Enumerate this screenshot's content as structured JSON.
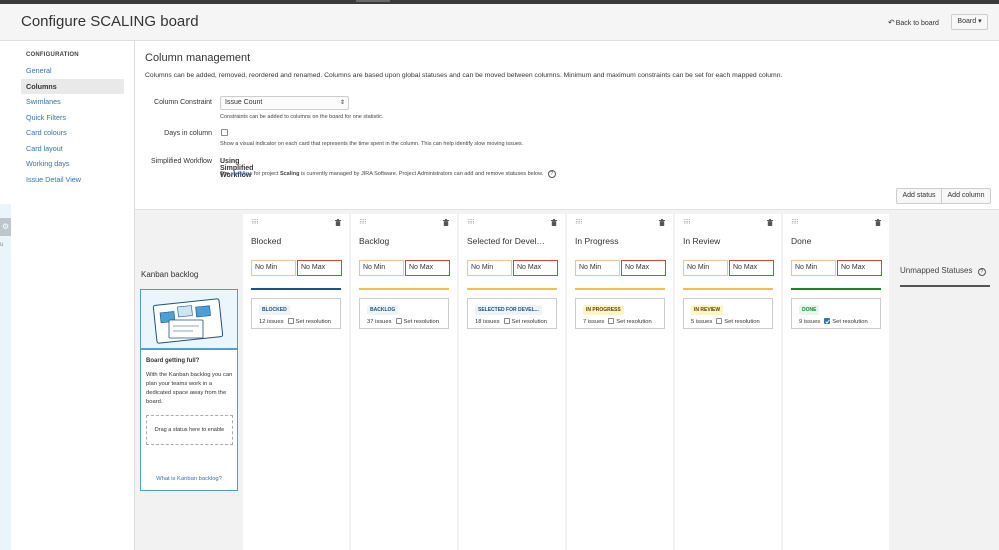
{
  "header": {
    "title": "Configure SCALING board",
    "back_link": "Back to board",
    "board_button": "Board"
  },
  "sidebar": {
    "section": "CONFIGURATION",
    "items": [
      {
        "label": "General"
      },
      {
        "label": "Columns"
      },
      {
        "label": "Swimlanes"
      },
      {
        "label": "Quick Filters"
      },
      {
        "label": "Card colours"
      },
      {
        "label": "Card layout"
      },
      {
        "label": "Working days"
      },
      {
        "label": "Issue Detail View"
      }
    ]
  },
  "main": {
    "title": "Column management",
    "description": "Columns can be added, removed, reordered and renamed. Columns are based upon global statuses and can be moved between columns. Minimum and maximum constraints can be set for each mapped column.",
    "constraint": {
      "label": "Column Constraint",
      "value": "Issue Count",
      "help": "Constraints can be added to columns on the board for one statistic."
    },
    "days_in_column": {
      "label": "Days in column",
      "checked": false,
      "help": "Show a visual indicator on each card that represents the time spent in the column. This can help identify slow moving issues."
    },
    "workflow": {
      "label": "Simplified Workflow",
      "value": "Using Simplified Workflow",
      "help_prefix": "The",
      "help_link": "workflow",
      "help_mid": "for project",
      "help_project": "Scaling",
      "help_suffix": "is currently managed by JIRA Software. Project Administrators can add and remove statuses below."
    },
    "add_status": "Add status",
    "add_column": "Add column"
  },
  "kanban": {
    "title": "Kanban backlog",
    "card_heading": "Board getting full?",
    "card_body": "With the Kanban backlog you can plan your teams work in a dedicated space away from the board.",
    "dropzone": "Drag a status here to enable",
    "link": "What is Kanban backlog?"
  },
  "columns": [
    {
      "name": "Blocked",
      "min": "No Min",
      "max": "No Max",
      "bar_color": "#205081",
      "status": "BLOCKED",
      "status_color": "#205081",
      "status_bg": "#eef3f8",
      "issues": "12 issues",
      "resolution": "Set resolution",
      "resolution_checked": false
    },
    {
      "name": "Backlog",
      "min": "No Min",
      "max": "No Max",
      "bar_color": "#f0c040",
      "status": "BACKLOG",
      "status_color": "#205081",
      "status_bg": "#eef3f8",
      "issues": "37 issues",
      "resolution": "Set resolution",
      "resolution_checked": false
    },
    {
      "name": "Selected for Devel…",
      "min": "No Min",
      "max": "No Max",
      "bar_color": "#f0c040",
      "status": "SELECTED FOR DEVEL...",
      "status_color": "#205081",
      "status_bg": "#eef3f8",
      "issues": "18 issues",
      "resolution": "Set resolution",
      "resolution_checked": false
    },
    {
      "name": "In Progress",
      "min": "No Min",
      "max": "No Max",
      "bar_color": "#f0c040",
      "status": "IN PROGRESS",
      "status_color": "#594300",
      "status_bg": "#fff4c4",
      "issues": "7 issues",
      "resolution": "Set resolution",
      "resolution_checked": false
    },
    {
      "name": "In Review",
      "min": "No Min",
      "max": "No Max",
      "bar_color": "#f0c040",
      "status": "IN REVIEW",
      "status_color": "#594300",
      "status_bg": "#fff4c4",
      "issues": "5 issues",
      "resolution": "Set resolution",
      "resolution_checked": false
    },
    {
      "name": "Done",
      "min": "No Min",
      "max": "No Max",
      "bar_color": "#14892c",
      "status": "DONE",
      "status_color": "#14892c",
      "status_bg": "#e7f5ea",
      "issues": "9 issues",
      "resolution": "Set resolution",
      "resolution_checked": true
    }
  ],
  "unmapped": "Unmapped Statuses"
}
